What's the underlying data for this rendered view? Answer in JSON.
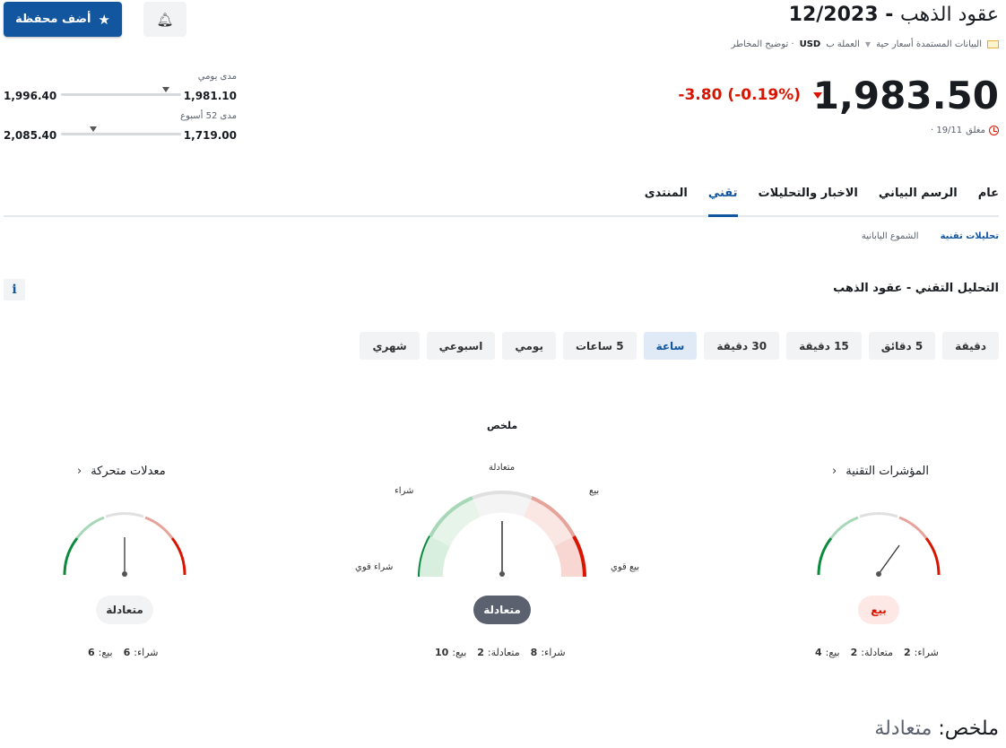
{
  "header": {
    "name": "عقود الذهب",
    "contract": "12/2023",
    "meta_data_label": "البيانات المستمدة أسعار حية",
    "meta_currency_label": "العملة ب",
    "meta_currency": "USD",
    "meta_risk": "· توضيح المخاطر",
    "price": "1,983.50",
    "change": "-3.80",
    "change_pct": "(-0.19%)",
    "closed_label": "مغلق",
    "closed_date": "19/11 ·",
    "add_portfolio": "أضف محفظة"
  },
  "ranges": {
    "daily": {
      "label": "مدى يومي",
      "low": "1,981.10",
      "high": "1,996.40",
      "position": 0.13
    },
    "week52": {
      "label": "مدى 52 أسبوع",
      "low": "1,719.00",
      "high": "2,085.40",
      "position": 0.73
    }
  },
  "tabs": [
    "عام",
    "الرسم البياني",
    "الاخبار والتحليلات",
    "تقني",
    "المنتدى"
  ],
  "active_tab": "تقني",
  "subtabs": [
    "تحليلات تقنية",
    "الشموع اليابانية"
  ],
  "section_title": "التحليل التقني - عقود الذهب",
  "periods": [
    "دقيقة",
    "5 دقائق",
    "15 دقيقة",
    "30 دقيقة",
    "ساعة",
    "5 ساعات",
    "يومي",
    "اسبوعي",
    "شهري"
  ],
  "active_period": "ساعة",
  "gauges": {
    "summary": {
      "title": "ملخص",
      "labels": {
        "strong_buy": "شراء قوي",
        "buy": "شراء",
        "neutral": "متعادلة",
        "sell": "بيع",
        "strong_sell": "بيع قوي"
      },
      "verdict": "متعادلة",
      "buy_label": "شراء:",
      "buy": "8",
      "neutral_label": "متعادلة:",
      "neutral": "2",
      "sell_label": "بيع:",
      "sell": "10"
    },
    "indicators": {
      "title": "المؤشرات التقنية",
      "verdict": "بيع",
      "buy_label": "شراء:",
      "buy": "2",
      "neutral_label": "متعادلة:",
      "neutral": "2",
      "sell_label": "بيع:",
      "sell": "4"
    },
    "moving_averages": {
      "title": "معدلات متحركة",
      "verdict": "متعادلة",
      "buy_label": "شراء:",
      "buy": "6",
      "sell_label": "بيع:",
      "sell": "6"
    }
  },
  "bottom_summary": {
    "label": "ملخص:",
    "value": "متعادلة"
  },
  "colors": {
    "accent": "#1256a0",
    "negative": "#d91400",
    "buy": "#0b8a3e",
    "sell": "#d91400"
  }
}
